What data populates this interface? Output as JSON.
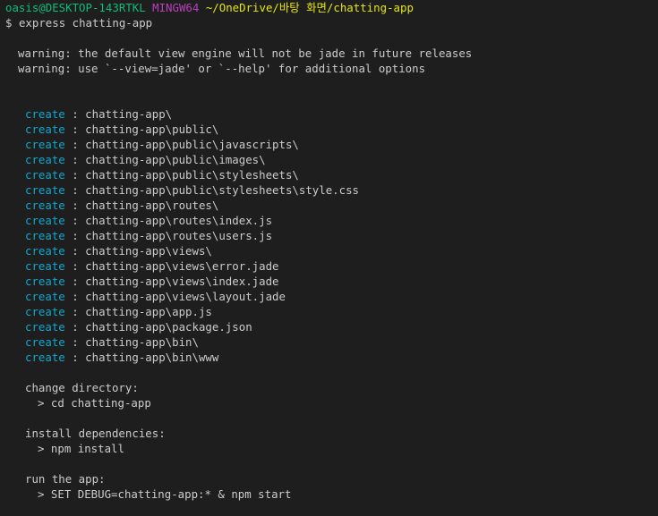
{
  "prompt": {
    "user_host": "oasis@DESKTOP-143RTKL",
    "system": "MINGW64",
    "path": "~/OneDrive/바탕 화면/chatting-app",
    "symbol": "$",
    "command": "express chatting-app"
  },
  "warnings": [
    "warning: the default view engine will not be jade in future releases",
    "warning: use `--view=jade' or `--help' for additional options"
  ],
  "create_keyword": "create",
  "separator": " : ",
  "created_paths": [
    "chatting-app\\",
    "chatting-app\\public\\",
    "chatting-app\\public\\javascripts\\",
    "chatting-app\\public\\images\\",
    "chatting-app\\public\\stylesheets\\",
    "chatting-app\\public\\stylesheets\\style.css",
    "chatting-app\\routes\\",
    "chatting-app\\routes\\index.js",
    "chatting-app\\routes\\users.js",
    "chatting-app\\views\\",
    "chatting-app\\views\\error.jade",
    "chatting-app\\views\\index.jade",
    "chatting-app\\views\\layout.jade",
    "chatting-app\\app.js",
    "chatting-app\\package.json",
    "chatting-app\\bin\\",
    "chatting-app\\bin\\www"
  ],
  "instructions": [
    {
      "heading": "change directory:",
      "command": "> cd chatting-app"
    },
    {
      "heading": "install dependencies:",
      "command": "> npm install"
    },
    {
      "heading": "run the app:",
      "command": "> SET DEBUG=chatting-app:* & npm start"
    }
  ],
  "colors": {
    "background": "#1e1e1e",
    "text": "#cccccc",
    "user_host": "#0dbc79",
    "system": "#bc3fbc",
    "path": "#e5e510",
    "create": "#11a8cd"
  }
}
